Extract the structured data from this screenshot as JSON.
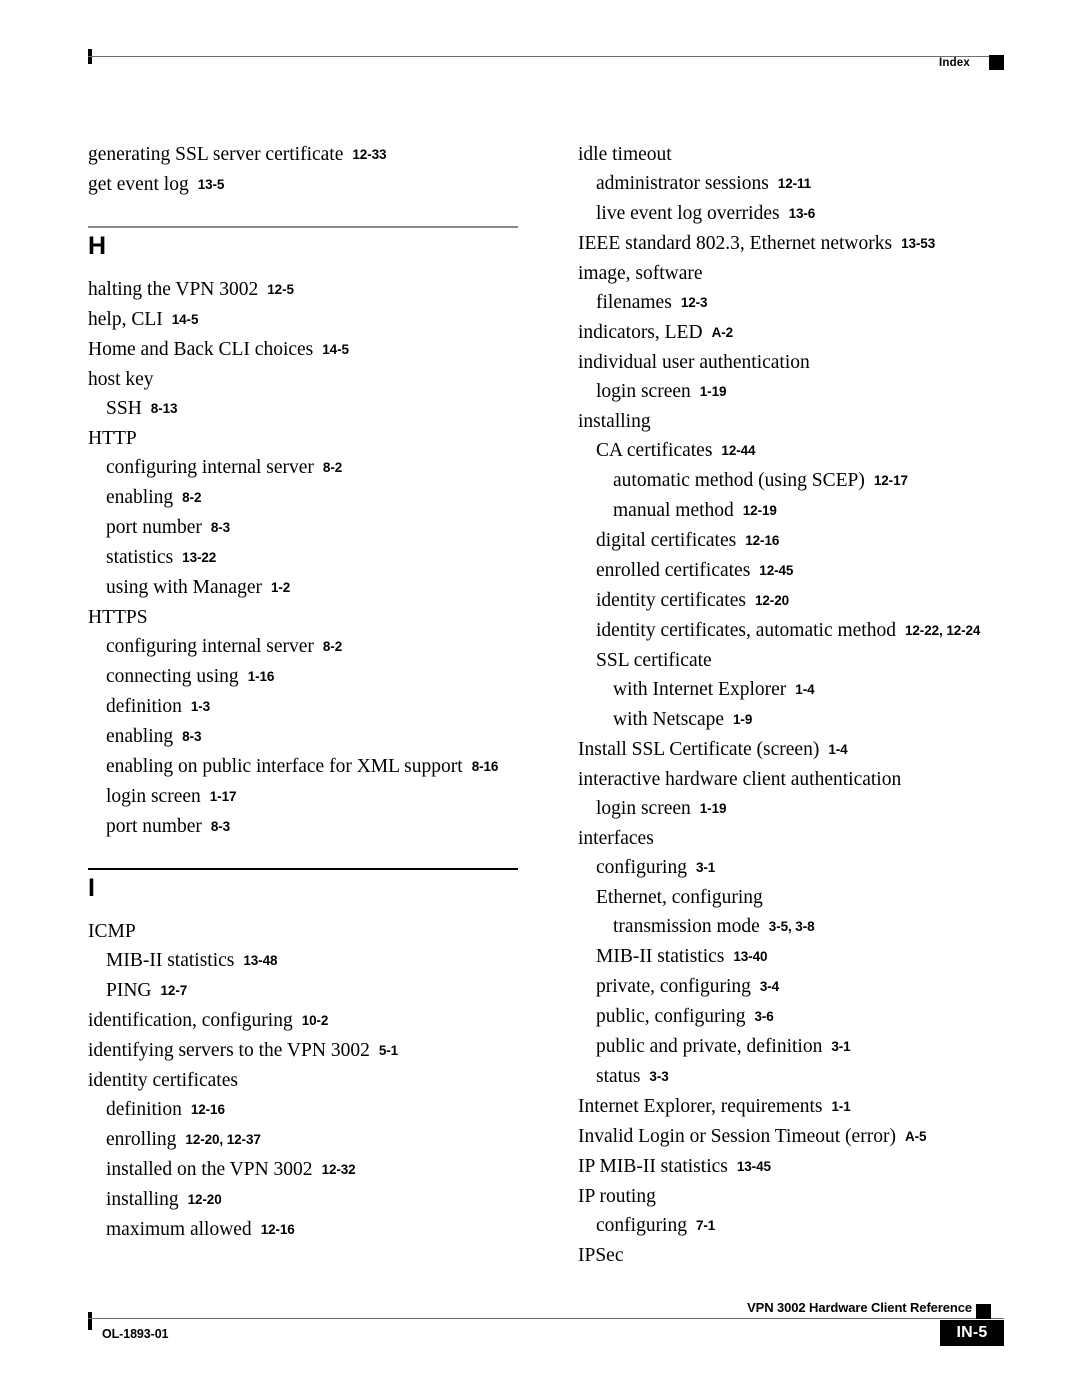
{
  "header": {
    "label": "Index",
    "marker_icon": "black-square-marker"
  },
  "footer": {
    "doc_id": "OL-1893-01",
    "doc_title": "VPN 3002 Hardware Client Reference",
    "page_number": "IN-5",
    "marker_icon": "black-square-marker"
  },
  "left_column": [
    {
      "type": "entries",
      "items": [
        {
          "level": 0,
          "term": "generating SSL server certificate",
          "pages": "12-33"
        },
        {
          "level": 0,
          "term": "get event log",
          "pages": "13-5"
        }
      ]
    },
    {
      "type": "letter",
      "letter": "H",
      "items": [
        {
          "level": 0,
          "term": "halting the VPN 3002",
          "pages": "12-5"
        },
        {
          "level": 0,
          "term": "help, CLI",
          "pages": "14-5"
        },
        {
          "level": 0,
          "term": "Home and Back CLI choices",
          "pages": "14-5"
        },
        {
          "level": 0,
          "term": "host key",
          "pages": ""
        },
        {
          "level": 1,
          "term": "SSH",
          "pages": "8-13"
        },
        {
          "level": 0,
          "term": "HTTP",
          "pages": ""
        },
        {
          "level": 1,
          "term": "configuring internal server",
          "pages": "8-2"
        },
        {
          "level": 1,
          "term": "enabling",
          "pages": "8-2"
        },
        {
          "level": 1,
          "term": "port number",
          "pages": "8-3"
        },
        {
          "level": 1,
          "term": "statistics",
          "pages": "13-22"
        },
        {
          "level": 1,
          "term": "using with Manager",
          "pages": "1-2"
        },
        {
          "level": 0,
          "term": "HTTPS",
          "pages": ""
        },
        {
          "level": 1,
          "term": "configuring internal server",
          "pages": "8-2"
        },
        {
          "level": 1,
          "term": "connecting using",
          "pages": "1-16"
        },
        {
          "level": 1,
          "term": "definition",
          "pages": "1-3"
        },
        {
          "level": 1,
          "term": "enabling",
          "pages": "8-3"
        },
        {
          "level": 1,
          "term": "enabling on public interface for XML support",
          "pages": "8-16"
        },
        {
          "level": 1,
          "term": "login screen",
          "pages": "1-17"
        },
        {
          "level": 1,
          "term": "port number",
          "pages": "8-3"
        }
      ]
    },
    {
      "type": "letter",
      "letter": "I",
      "dark": true,
      "items": [
        {
          "level": 0,
          "term": "ICMP",
          "pages": ""
        },
        {
          "level": 1,
          "term": "MIB-II statistics",
          "pages": "13-48"
        },
        {
          "level": 1,
          "term": "PING",
          "pages": "12-7"
        },
        {
          "level": 0,
          "term": "identification, configuring",
          "pages": "10-2"
        },
        {
          "level": 0,
          "term": "identifying servers to the VPN 3002",
          "pages": "5-1"
        },
        {
          "level": 0,
          "term": "identity certificates",
          "pages": ""
        },
        {
          "level": 1,
          "term": "definition",
          "pages": "12-16"
        },
        {
          "level": 1,
          "term": "enrolling",
          "pages": "12-20, 12-37"
        },
        {
          "level": 1,
          "term": "installed on the VPN 3002",
          "pages": "12-32"
        },
        {
          "level": 1,
          "term": "installing",
          "pages": "12-20"
        },
        {
          "level": 1,
          "term": "maximum allowed",
          "pages": "12-16"
        }
      ]
    }
  ],
  "right_column": [
    {
      "type": "entries",
      "items": [
        {
          "level": 0,
          "term": "idle timeout",
          "pages": ""
        },
        {
          "level": 1,
          "term": "administrator sessions",
          "pages": "12-11"
        },
        {
          "level": 1,
          "term": "live event log overrides",
          "pages": "13-6"
        },
        {
          "level": 0,
          "term": "IEEE standard 802.3, Ethernet networks",
          "pages": "13-53"
        },
        {
          "level": 0,
          "term": "image, software",
          "pages": ""
        },
        {
          "level": 1,
          "term": "filenames",
          "pages": "12-3"
        },
        {
          "level": 0,
          "term": "indicators, LED",
          "pages": "A-2"
        },
        {
          "level": 0,
          "term": "individual user authentication",
          "pages": ""
        },
        {
          "level": 1,
          "term": "login screen",
          "pages": "1-19"
        },
        {
          "level": 0,
          "term": "installing",
          "pages": ""
        },
        {
          "level": 1,
          "term": "CA certificates",
          "pages": "12-44"
        },
        {
          "level": 2,
          "term": "automatic method (using SCEP)",
          "pages": "12-17"
        },
        {
          "level": 2,
          "term": "manual method",
          "pages": "12-19"
        },
        {
          "level": 1,
          "term": "digital certificates",
          "pages": "12-16"
        },
        {
          "level": 1,
          "term": "enrolled certificates",
          "pages": "12-45"
        },
        {
          "level": 1,
          "term": "identity certificates",
          "pages": "12-20"
        },
        {
          "level": 1,
          "term": "identity certificates, automatic method",
          "pages": "12-22, 12-24"
        },
        {
          "level": 1,
          "term": "SSL certificate",
          "pages": ""
        },
        {
          "level": 2,
          "term": "with Internet Explorer",
          "pages": "1-4"
        },
        {
          "level": 2,
          "term": "with Netscape",
          "pages": "1-9"
        },
        {
          "level": 0,
          "term": "Install SSL Certificate (screen)",
          "pages": "1-4"
        },
        {
          "level": 0,
          "term": "interactive hardware client authentication",
          "pages": ""
        },
        {
          "level": 1,
          "term": "login screen",
          "pages": "1-19"
        },
        {
          "level": 0,
          "term": "interfaces",
          "pages": ""
        },
        {
          "level": 1,
          "term": "configuring",
          "pages": "3-1"
        },
        {
          "level": 1,
          "term": "Ethernet, configuring",
          "pages": ""
        },
        {
          "level": 2,
          "term": "transmission mode",
          "pages": "3-5, 3-8"
        },
        {
          "level": 1,
          "term": "MIB-II statistics",
          "pages": "13-40"
        },
        {
          "level": 1,
          "term": "private, configuring",
          "pages": "3-4"
        },
        {
          "level": 1,
          "term": "public, configuring",
          "pages": "3-6"
        },
        {
          "level": 1,
          "term": "public and private, definition",
          "pages": "3-1"
        },
        {
          "level": 1,
          "term": "status",
          "pages": "3-3"
        },
        {
          "level": 0,
          "term": "Internet Explorer, requirements",
          "pages": "1-1"
        },
        {
          "level": 0,
          "term": "Invalid Login or Session Timeout (error)",
          "pages": "A-5"
        },
        {
          "level": 0,
          "term": "IP MIB-II statistics",
          "pages": "13-45"
        },
        {
          "level": 0,
          "term": "IP routing",
          "pages": ""
        },
        {
          "level": 1,
          "term": "configuring",
          "pages": "7-1"
        },
        {
          "level": 0,
          "term": "IPSec",
          "pages": ""
        }
      ]
    }
  ]
}
